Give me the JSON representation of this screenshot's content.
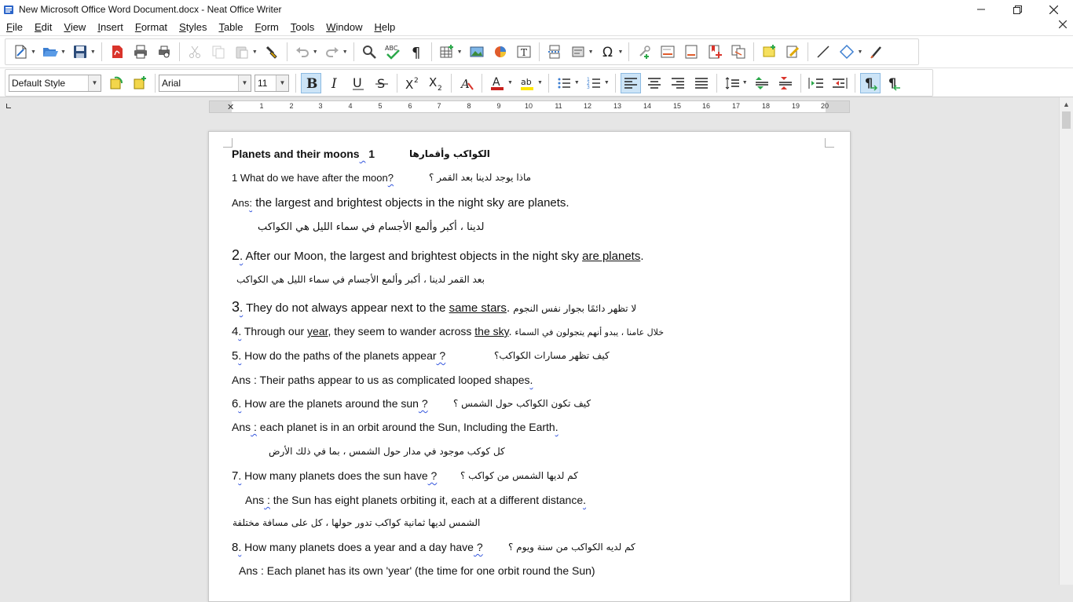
{
  "window": {
    "title": "New Microsoft Office Word Document.docx - Neat Office Writer"
  },
  "menu": [
    "File",
    "Edit",
    "View",
    "Insert",
    "Format",
    "Styles",
    "Table",
    "Form",
    "Tools",
    "Window",
    "Help"
  ],
  "format_bar": {
    "paragraph_style": "Default Style",
    "font_name": "Arial",
    "font_size": "11"
  },
  "ruler": {
    "numbers": [
      "1",
      "2",
      "3",
      "4",
      "5",
      "6",
      "7",
      "8",
      "9",
      "10",
      "11",
      "12",
      "13",
      "14",
      "15",
      "16",
      "17",
      "18",
      "19",
      "20"
    ]
  },
  "document": {
    "l1_en": "Planets and their moons",
    "l1_num": " 1",
    "l1_ar": "الكواكب وأقمارها",
    "l2_en": "1 What do we have after the moon",
    "l2_q": "?",
    "l2_ar": "ماذا يوجد لدينا بعد القمر ؟",
    "l3_label": "Ans",
    "l3_colon": ":",
    "l3_text": " the largest and brightest objects in the night sky are planets.",
    "l4_ar": "لدينا ، أكبر وألمع الأجسام في سماء الليل هي الكواكب",
    "l5_num": "2",
    "l5_dot": ".",
    "l5_text": " After our Moon, the largest and brightest objects in the night sky ",
    "l5_ul": "are planets",
    "l5_end": ".",
    "l6_ar": "بعد القمر لدينا ، أكبر وألمع الأجسام في سماء الليل هي الكواكب",
    "l7_num": "3",
    "l7_dot": ".",
    "l7_text": " They do not always appear next to the ",
    "l7_ul": "same stars",
    "l7_end": ". ",
    "l7_ar": "لا تظهر دائمًا بجوار نفس النجوم",
    "l8_num": "4",
    "l8_dot": ".",
    "l8_t1": " Through our ",
    "l8_ul1": "year",
    "l8_t2": ", they seem to wander across ",
    "l8_ul2": "the sky",
    "l8_end": ". ",
    "l8_ar": "خلال عامنا ، يبدو أنهم يتجولون في السماء",
    "l9_num": "5",
    "l9_dot": ".",
    "l9_text": " How do the paths of the planets appear",
    "l9_q": " ?",
    "l9_ar": "كيف تظهر مسارات الكواكب؟",
    "l10_text": " Ans : Their paths appear to us as complicated looped shapes",
    "l10_dot": ".",
    "l11_num": "6",
    "l11_dot": ".",
    "l11_text": " How are the planets around the sun",
    "l11_q": " ?",
    "l11_ar": "كيف تكون الكواكب حول الشمس ؟",
    "l12_label": " Ans",
    "l12_colon": " :",
    "l12_text": " each planet is in an orbit around the Sun, Including the Earth",
    "l12_dot": ".",
    "l13_ar": "كل كوكب موجود في مدار حول الشمس ، بما في ذلك الأرض",
    "l14_num": "7",
    "l14_dot": ".",
    "l14_text": " How many planets does the sun have",
    "l14_q": " ?",
    "l14_ar": "كم لديها الشمس من كواكب ؟",
    "l15_label": "Ans",
    "l15_colon": " :",
    "l15_text": " the Sun has eight planets orbiting it, each at a different distance",
    "l15_dot": ".",
    "l16_ar": "الشمس لديها ثمانية كواكب تدور حولها ، كل على مسافة مختلفة",
    "l17_num": "8",
    "l17_dot": ".",
    "l17_text": " How many planets does a year and a day have",
    "l17_q": " ?",
    "l17_ar": "كم لديه الكواكب من سنة ويوم ؟",
    "l18_text": "Ans :  Each planet has its own 'year' (the time for one orbit round the Sun)"
  }
}
